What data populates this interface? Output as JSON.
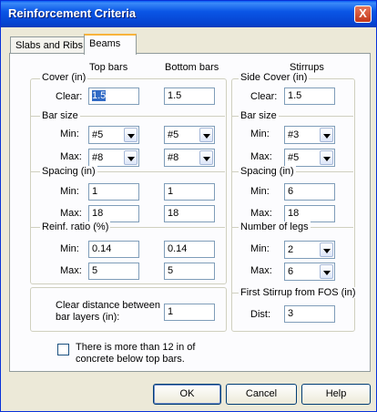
{
  "window": {
    "title": "Reinforcement Criteria",
    "close_glyph": "X"
  },
  "tabs": [
    {
      "label": "Slabs and Ribs"
    },
    {
      "label": "Beams"
    }
  ],
  "headers": {
    "top_bars": "Top bars",
    "bottom_bars": "Bottom bars",
    "stirrups": "Stirrups"
  },
  "cover": {
    "group_label": "Cover (in)",
    "clear_label": "Clear:",
    "top_clear": "1.5",
    "bottom_clear": "1.5"
  },
  "bar_size": {
    "group_label": "Bar size",
    "min_label": "Min:",
    "max_label": "Max:",
    "top_min": "#5",
    "bottom_min": "#5",
    "top_max": "#8",
    "bottom_max": "#8"
  },
  "spacing": {
    "group_label": "Spacing (in)",
    "min_label": "Min:",
    "max_label": "Max:",
    "top_min": "1",
    "bottom_min": "1",
    "top_max": "18",
    "bottom_max": "18"
  },
  "reinf_ratio": {
    "group_label": "Reinf. ratio (%)",
    "min_label": "Min:",
    "max_label": "Max:",
    "top_min": "0.14",
    "bottom_min": "0.14",
    "top_max": "5",
    "bottom_max": "5"
  },
  "clear_distance": {
    "label_line1": "Clear distance between",
    "label_line2": "bar layers (in):",
    "value": "1"
  },
  "stirrups": {
    "side_cover": {
      "group_label": "Side Cover (in)",
      "clear_label": "Clear:",
      "value": "1.5"
    },
    "bar_size": {
      "group_label": "Bar size",
      "min_label": "Min:",
      "min_value": "#3",
      "max_label": "Max:",
      "max_value": "#5"
    },
    "spacing": {
      "group_label": "Spacing (in)",
      "min_label": "Min:",
      "min_value": "6",
      "max_label": "Max:",
      "max_value": "18"
    },
    "legs": {
      "group_label": "Number of legs",
      "min_label": "Min:",
      "min_value": "2",
      "max_label": "Max:",
      "max_value": "6"
    },
    "first_stirrup": {
      "group_label": "First Stirrup from FOS (in)",
      "dist_label": "Dist:",
      "value": "3"
    }
  },
  "concrete_check": {
    "checked": false,
    "label_line1": "There is more than 12 in of",
    "label_line2": "concrete below top bars."
  },
  "buttons": {
    "ok": "OK",
    "cancel": "Cancel",
    "help": "Help"
  }
}
